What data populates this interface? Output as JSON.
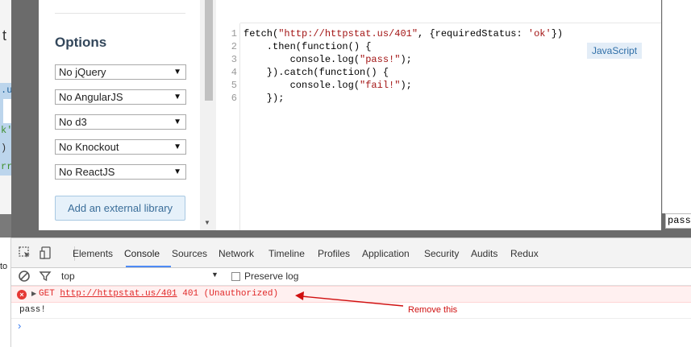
{
  "options_panel": {
    "title": "Options",
    "selects": [
      "No jQuery",
      "No AngularJS",
      "No d3",
      "No Knockout",
      "No ReactJS"
    ],
    "external_library_button": "Add an external library"
  },
  "editor": {
    "language_badge": "JavaScript",
    "lines": [
      {
        "n": "1",
        "parts": [
          [
            "fetch(",
            ""
          ],
          [
            "\"http://httpstat.us/401\"",
            "str"
          ],
          [
            ", {requiredStatus: ",
            ""
          ],
          [
            "'ok'",
            "str"
          ],
          [
            "})",
            ""
          ]
        ]
      },
      {
        "n": "2",
        "parts": [
          [
            "    .then(function() {",
            ""
          ]
        ]
      },
      {
        "n": "3",
        "parts": [
          [
            "        console.log(",
            ""
          ],
          [
            "\"pass!\"",
            "str"
          ],
          [
            ");",
            ""
          ]
        ]
      },
      {
        "n": "4",
        "parts": [
          [
            "    }).catch(function() {",
            ""
          ]
        ]
      },
      {
        "n": "5",
        "parts": [
          [
            "        console.log(",
            ""
          ],
          [
            "\"fail!\"",
            "str"
          ],
          [
            ");",
            ""
          ]
        ]
      },
      {
        "n": "6",
        "parts": [
          [
            "    });",
            ""
          ]
        ]
      }
    ]
  },
  "result_pane": {
    "output_fragment": "pass"
  },
  "left_strip": {
    "fragments": [
      "t",
      ".u",
      "k'",
      ")",
      "rr"
    ]
  },
  "devtools": {
    "left_fragment": "to",
    "tabs": [
      "Elements",
      "Console",
      "Sources",
      "Network",
      "Timeline",
      "Profiles",
      "Application",
      "Security",
      "Audits",
      "Redux"
    ],
    "active_tab": "Console",
    "filter_context": "top",
    "preserve_log_label": "Preserve log",
    "error": {
      "method": "GET",
      "url": "http://httpstat.us/401",
      "status": "401 (Unauthorized)"
    },
    "log_output": "pass!",
    "prompt_symbol": "›"
  },
  "annotation": {
    "text": "Remove this",
    "color": "#d01010"
  }
}
